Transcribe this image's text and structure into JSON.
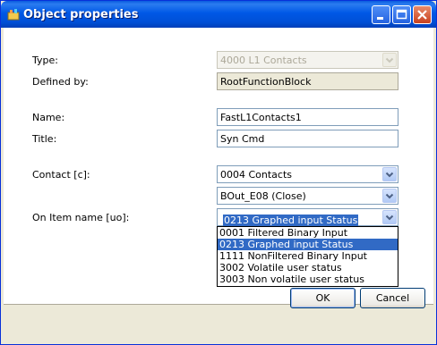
{
  "window": {
    "title": "Object properties",
    "controls": {
      "minimize": "minimize-icon",
      "maximize": "maximize-icon",
      "close": "close-icon"
    }
  },
  "form": {
    "type": {
      "label": "Type:",
      "value": "4000  L1 Contacts"
    },
    "defined_by": {
      "label": "Defined by:",
      "value": "RootFunctionBlock"
    },
    "name": {
      "label": "Name:",
      "value": "FastL1Contacts1"
    },
    "title": {
      "label": "Title:",
      "value": "Syn Cmd"
    },
    "contact": {
      "label": "Contact [c]:",
      "value": "0004  Contacts",
      "sub_value": "BOut_E08 (Close)"
    },
    "on_item": {
      "label": "On Item name [uo]:",
      "value": "0213  Graphed input Status",
      "options": [
        "0001  Filtered Binary Input",
        "0213  Graphed input Status",
        "1111  NonFiltered Binary Input",
        "3002  Volatile user status",
        "3003  Non volatile user status"
      ],
      "selected_index": 1
    }
  },
  "buttons": {
    "ok": "OK",
    "cancel": "Cancel"
  },
  "colors": {
    "titlebar": "#0058e6",
    "selection": "#316ac5",
    "dialog_bg": "#ece9d8"
  }
}
